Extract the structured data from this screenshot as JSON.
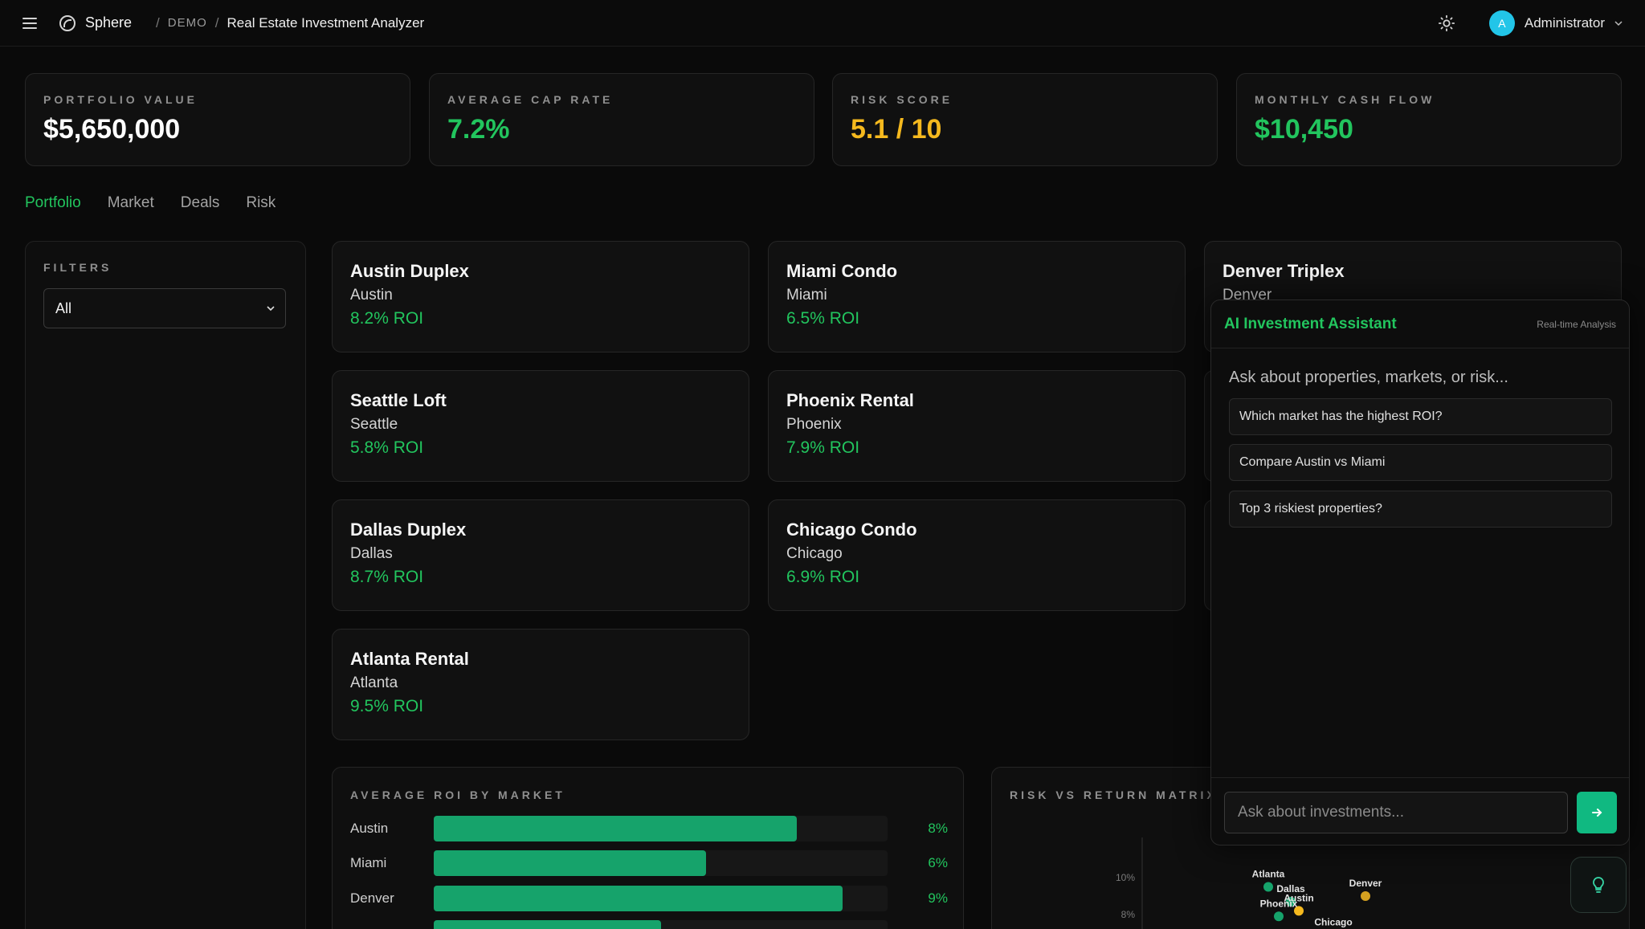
{
  "topbar": {
    "app_name": "Sphere",
    "sep1": "/",
    "crumb_demo": "DEMO",
    "sep2": "/",
    "page_title": "Real Estate Investment Analyzer",
    "avatar_initial": "A",
    "user_name": "Administrator"
  },
  "stats": [
    {
      "label": "PORTFOLIO VALUE",
      "value": "$5,650,000",
      "color": "#ffffff"
    },
    {
      "label": "AVERAGE CAP RATE",
      "value": "7.2%",
      "color": "#22c55e"
    },
    {
      "label": "RISK SCORE",
      "value": "5.1 / 10",
      "color": "#f5b91e"
    },
    {
      "label": "MONTHLY CASH FLOW",
      "value": "$10,450",
      "color": "#22c55e"
    }
  ],
  "tabs": [
    "Portfolio",
    "Market",
    "Deals",
    "Risk"
  ],
  "filters": {
    "label": "FILTERS",
    "selected": "All"
  },
  "properties": [
    {
      "name": "Austin Duplex",
      "city": "Austin",
      "roi": "8.2% ROI"
    },
    {
      "name": "Miami Condo",
      "city": "Miami",
      "roi": "6.5% ROI"
    },
    {
      "name": "Denver Triplex",
      "city": "Denver",
      "roi": ""
    },
    {
      "name": "Seattle Loft",
      "city": "Seattle",
      "roi": "5.8% ROI"
    },
    {
      "name": "Phoenix Rental",
      "city": "Phoenix",
      "roi": "7.9% ROI"
    },
    {
      "name": "Dallas Duplex",
      "city": "Dallas",
      "roi": "8.7% ROI"
    },
    {
      "name": "Chicago Condo",
      "city": "Chicago",
      "roi": "6.9% ROI"
    },
    {
      "name": "Atlanta Rental",
      "city": "Atlanta",
      "roi": "9.5% ROI"
    }
  ],
  "roi_chart": {
    "title": "AVERAGE ROI BY MARKET",
    "rows": [
      {
        "market": "Austin",
        "label": "8%",
        "fraction": 0.8
      },
      {
        "market": "Miami",
        "label": "6%",
        "fraction": 0.6
      },
      {
        "market": "Denver",
        "label": "9%",
        "fraction": 0.9
      },
      {
        "market": "",
        "label": "",
        "fraction": 0.5
      }
    ]
  },
  "chart_data": {
    "type": "scatter",
    "title": "RISK VS RETURN MATRIX",
    "ytick_labels": [
      "10%",
      "8%"
    ],
    "points": [
      {
        "label": "Atlanta",
        "y": 9.5,
        "color": "#16a36b"
      },
      {
        "label": "Dallas",
        "y": 8.7,
        "color": "#16a36b"
      },
      {
        "label": "Austin",
        "y": 8.2,
        "color": "#f5b91e"
      },
      {
        "label": "Phoenix",
        "y": 7.9,
        "color": "#16a36b"
      },
      {
        "label": "Chicago",
        "y": 6.9,
        "color": "#f5b91e"
      },
      {
        "label": "Denver",
        "y": 9.0,
        "color": "#d4a020"
      }
    ]
  },
  "ai": {
    "title": "AI Investment Assistant",
    "subtitle": "Real-time Analysis",
    "prompt": "Ask about properties, markets, or risk...",
    "suggestions": [
      "Which market has the highest ROI?",
      "Compare Austin vs Miami",
      "Top 3 riskiest properties?"
    ],
    "input_placeholder": "Ask about investments..."
  }
}
